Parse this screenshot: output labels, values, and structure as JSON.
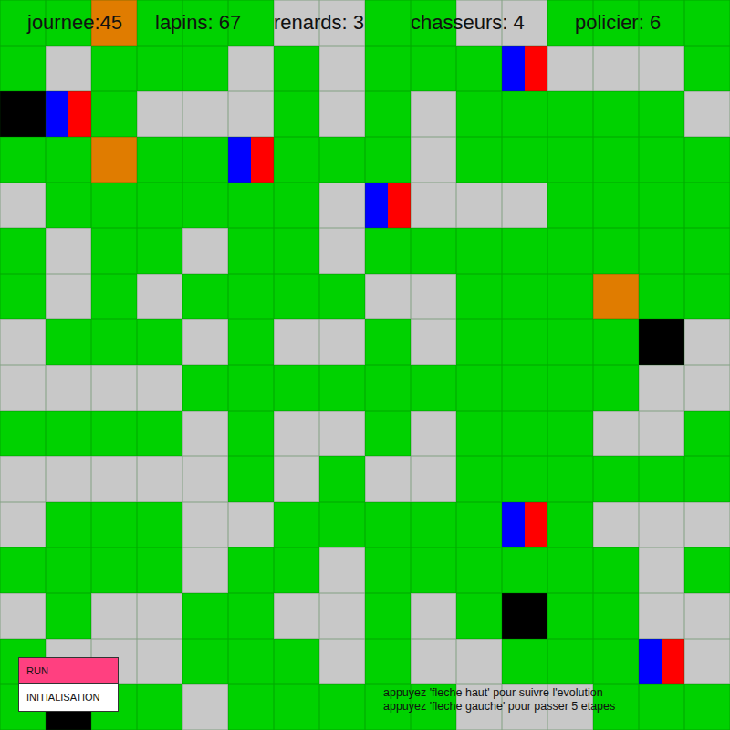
{
  "header": [
    "journee:45",
    "lapins: 67",
    "renards: 3",
    "chasseurs: 4",
    "policier: 6"
  ],
  "buttons": [
    "RUN",
    "INITIALISATION"
  ],
  "help": [
    "appuyez 'fleche haut' pour suivre l'evolution",
    "appuyez 'fleche gauche' pour passer 5 etapes"
  ],
  "grid": [
    [
      "grass",
      "grass",
      "fox",
      "grass",
      "grass",
      "grass",
      "rabbit",
      "rabbit",
      "grass",
      "grass",
      "rabbit",
      "rabbit",
      "grass",
      "grass",
      "grass",
      "grass"
    ],
    [
      "grass",
      "rabbit",
      "grass",
      "grass",
      "grass",
      "rabbit",
      "grass",
      "rabbit",
      "grass",
      "grass",
      "grass",
      "police",
      "rabbit",
      "rabbit",
      "rabbit",
      "grass"
    ],
    [
      "hunter",
      "police",
      "grass",
      "rabbit",
      "rabbit",
      "rabbit",
      "grass",
      "rabbit",
      "grass",
      "rabbit",
      "grass",
      "grass",
      "grass",
      "grass",
      "grass",
      "rabbit"
    ],
    [
      "grass",
      "grass",
      "fox",
      "grass",
      "grass",
      "police",
      "grass",
      "grass",
      "grass",
      "rabbit",
      "grass",
      "grass",
      "grass",
      "grass",
      "grass",
      "grass"
    ],
    [
      "rabbit",
      "grass",
      "grass",
      "grass",
      "grass",
      "grass",
      "grass",
      "rabbit",
      "police",
      "rabbit",
      "rabbit",
      "rabbit",
      "grass",
      "grass",
      "grass",
      "grass"
    ],
    [
      "grass",
      "rabbit",
      "grass",
      "grass",
      "rabbit",
      "grass",
      "grass",
      "rabbit",
      "grass",
      "grass",
      "grass",
      "grass",
      "grass",
      "grass",
      "grass",
      "grass"
    ],
    [
      "grass",
      "rabbit",
      "grass",
      "rabbit",
      "grass",
      "grass",
      "grass",
      "grass",
      "rabbit",
      "rabbit",
      "grass",
      "grass",
      "grass",
      "fox",
      "grass",
      "grass"
    ],
    [
      "rabbit",
      "grass",
      "grass",
      "grass",
      "rabbit",
      "grass",
      "rabbit",
      "rabbit",
      "grass",
      "rabbit",
      "grass",
      "grass",
      "grass",
      "grass",
      "hunter",
      "rabbit"
    ],
    [
      "rabbit",
      "rabbit",
      "rabbit",
      "rabbit",
      "grass",
      "grass",
      "grass",
      "grass",
      "grass",
      "grass",
      "grass",
      "grass",
      "grass",
      "grass",
      "rabbit",
      "rabbit"
    ],
    [
      "grass",
      "grass",
      "grass",
      "grass",
      "rabbit",
      "grass",
      "rabbit",
      "rabbit",
      "grass",
      "rabbit",
      "grass",
      "grass",
      "grass",
      "rabbit",
      "rabbit",
      "grass"
    ],
    [
      "rabbit",
      "rabbit",
      "rabbit",
      "rabbit",
      "rabbit",
      "grass",
      "rabbit",
      "grass",
      "rabbit",
      "rabbit",
      "grass",
      "grass",
      "grass",
      "grass",
      "grass",
      "grass"
    ],
    [
      "rabbit",
      "grass",
      "grass",
      "grass",
      "rabbit",
      "rabbit",
      "grass",
      "grass",
      "grass",
      "grass",
      "grass",
      "police",
      "grass",
      "rabbit",
      "rabbit",
      "rabbit"
    ],
    [
      "grass",
      "grass",
      "grass",
      "grass",
      "rabbit",
      "grass",
      "grass",
      "rabbit",
      "grass",
      "grass",
      "grass",
      "grass",
      "grass",
      "grass",
      "rabbit",
      "grass"
    ],
    [
      "rabbit",
      "grass",
      "rabbit",
      "rabbit",
      "grass",
      "grass",
      "rabbit",
      "rabbit",
      "grass",
      "rabbit",
      "grass",
      "hunter",
      "grass",
      "grass",
      "rabbit",
      "rabbit"
    ],
    [
      "grass",
      "rabbit",
      "rabbit",
      "rabbit",
      "grass",
      "grass",
      "grass",
      "rabbit",
      "grass",
      "rabbit",
      "rabbit",
      "grass",
      "grass",
      "grass",
      "police",
      "rabbit"
    ],
    [
      "grass",
      "hunter",
      "grass",
      "grass",
      "rabbit",
      "grass",
      "grass",
      "grass",
      "grass",
      "grass",
      "rabbit",
      "rabbit",
      "rabbit",
      "grass",
      "grass",
      "grass"
    ]
  ]
}
